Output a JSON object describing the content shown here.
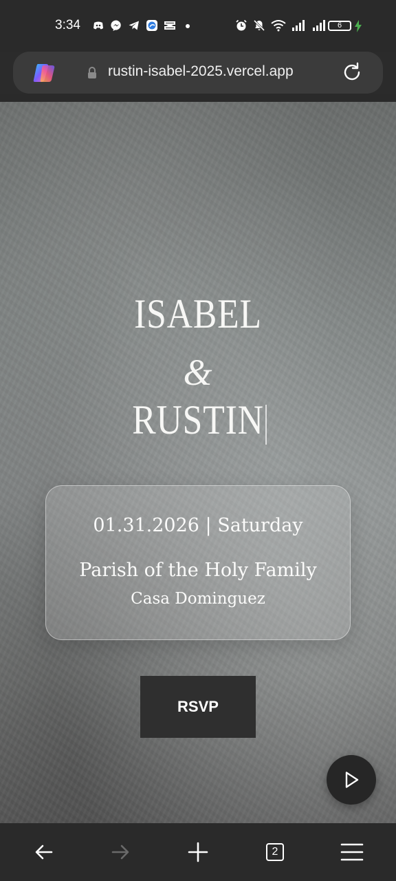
{
  "status_bar": {
    "time": "3:34",
    "left_icons": [
      "discord-icon",
      "messenger-icon",
      "telegram-icon",
      "edge-app-icon",
      "capcut-icon",
      "dot-icon"
    ],
    "right_icons": [
      "alarm-icon",
      "mute-icon",
      "wifi-icon",
      "signal-icon",
      "signal-icon"
    ],
    "battery_level": "6"
  },
  "browser": {
    "url": "rustin-isabel-2025.vercel.app",
    "tab_count": "2"
  },
  "invitation": {
    "name_1": "ISABEL",
    "ampersand": "&",
    "name_2": "RUSTIN",
    "date_line": "01.31.2026 | Saturday",
    "venue_line_1": "Parish of the Holy Family",
    "venue_line_2": "Casa Dominguez",
    "rsvp_label": "RSVP"
  },
  "colors": {
    "bar_background": "#2a2a2a",
    "url_pill": "#3b3b3b",
    "rsvp_button": "#2f2f2f",
    "charging": "#4caf50"
  }
}
